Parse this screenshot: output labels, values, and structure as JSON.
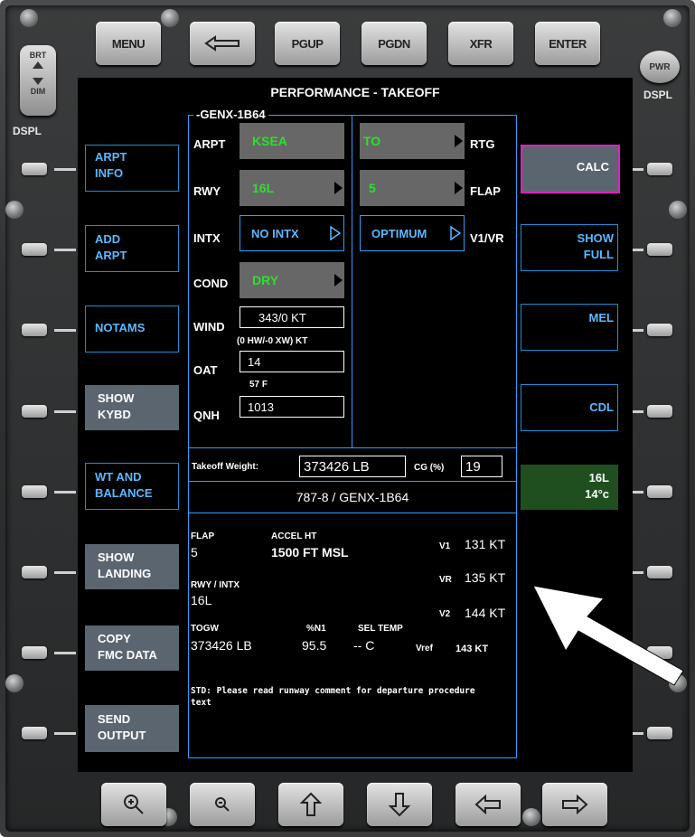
{
  "bezel": {
    "top_keys": [
      "MENU",
      "",
      "PGUP",
      "PGDN",
      "XFR",
      "ENTER"
    ],
    "left_brightness": {
      "top": "BRT",
      "bottom": "DIM",
      "label": "DSPL"
    },
    "right_power": {
      "label": "PWR",
      "sub": "DSPL"
    }
  },
  "screen": {
    "title": "PERFORMANCE - TAKEOFF",
    "engine_header": "-GENX-1B64",
    "left_softkeys": [
      {
        "line1": "ARPT",
        "line2": "INFO"
      },
      {
        "line1": "ADD",
        "line2": "ARPT"
      },
      {
        "line1": "NOTAMS",
        "line2": ""
      },
      {
        "line1": "SHOW",
        "line2": "KYBD"
      },
      {
        "line1": "WT AND",
        "line2": "BALANCE"
      },
      {
        "line1": "SHOW",
        "line2": "LANDING"
      },
      {
        "line1": "COPY",
        "line2": "FMC DATA"
      },
      {
        "line1": "SEND",
        "line2": "OUTPUT"
      }
    ],
    "right_softkeys": [
      {
        "line1": "CALC",
        "line2": ""
      },
      {
        "line1": "SHOW",
        "line2": "FULL"
      },
      {
        "line1": "MEL",
        "line2": ""
      },
      {
        "line1": "CDL",
        "line2": ""
      }
    ],
    "runway_badge": {
      "rwy": "16L",
      "temp": "14°c"
    },
    "inputs": {
      "arpt_label": "ARPT",
      "arpt_value": "KSEA",
      "rwy_label": "RWY",
      "rwy_value": "16L",
      "intx_label": "INTX",
      "intx_value": "NO INTX",
      "cond_label": "COND",
      "cond_value": "DRY",
      "wind_label": "WIND",
      "wind_value": "343/0 KT",
      "wind_sub": "(0 HW/-0 XW) KT",
      "oat_label": "OAT",
      "oat_value": "14",
      "oat_sub": "57 F",
      "qnh_label": "QNH",
      "qnh_value": "1013",
      "rtg_label": "RTG",
      "rtg_value": "TO",
      "flap_label": "FLAP",
      "flap_value": "5",
      "v1vr_label": "V1/VR",
      "v1vr_value": "OPTIMUM"
    },
    "weight": {
      "label": "Takeoff Weight:",
      "value": "373426 LB",
      "cg_label": "CG (%)",
      "cg_value": "19"
    },
    "aircraft": "787-8 / GENX-1B64",
    "results": {
      "flap_label": "FLAP",
      "flap_value": "5",
      "accel_label": "ACCEL HT",
      "accel_value": "1500 FT MSL",
      "rwy_label": "RWY / INTX",
      "rwy_value": "16L",
      "togw_label": "TOGW",
      "togw_value": "373426 LB",
      "n1_label": "%N1",
      "n1_value": "95.5",
      "sel_label": "SEL TEMP",
      "sel_value": "-- C",
      "v1_label": "V1",
      "v1_value": "131 KT",
      "vr_label": "VR",
      "vr_value": "135 KT",
      "v2_label": "V2",
      "v2_value": "144 KT",
      "vref_label": "Vref",
      "vref_value": "143 KT",
      "note": "STD: Please read runway comment for departure procedure text"
    }
  },
  "colors": {
    "accent_blue": "#2aa1ff",
    "green_value": "#2de02d",
    "calc_border": "#e020c0",
    "badge_bg": "#1f4f1f"
  }
}
